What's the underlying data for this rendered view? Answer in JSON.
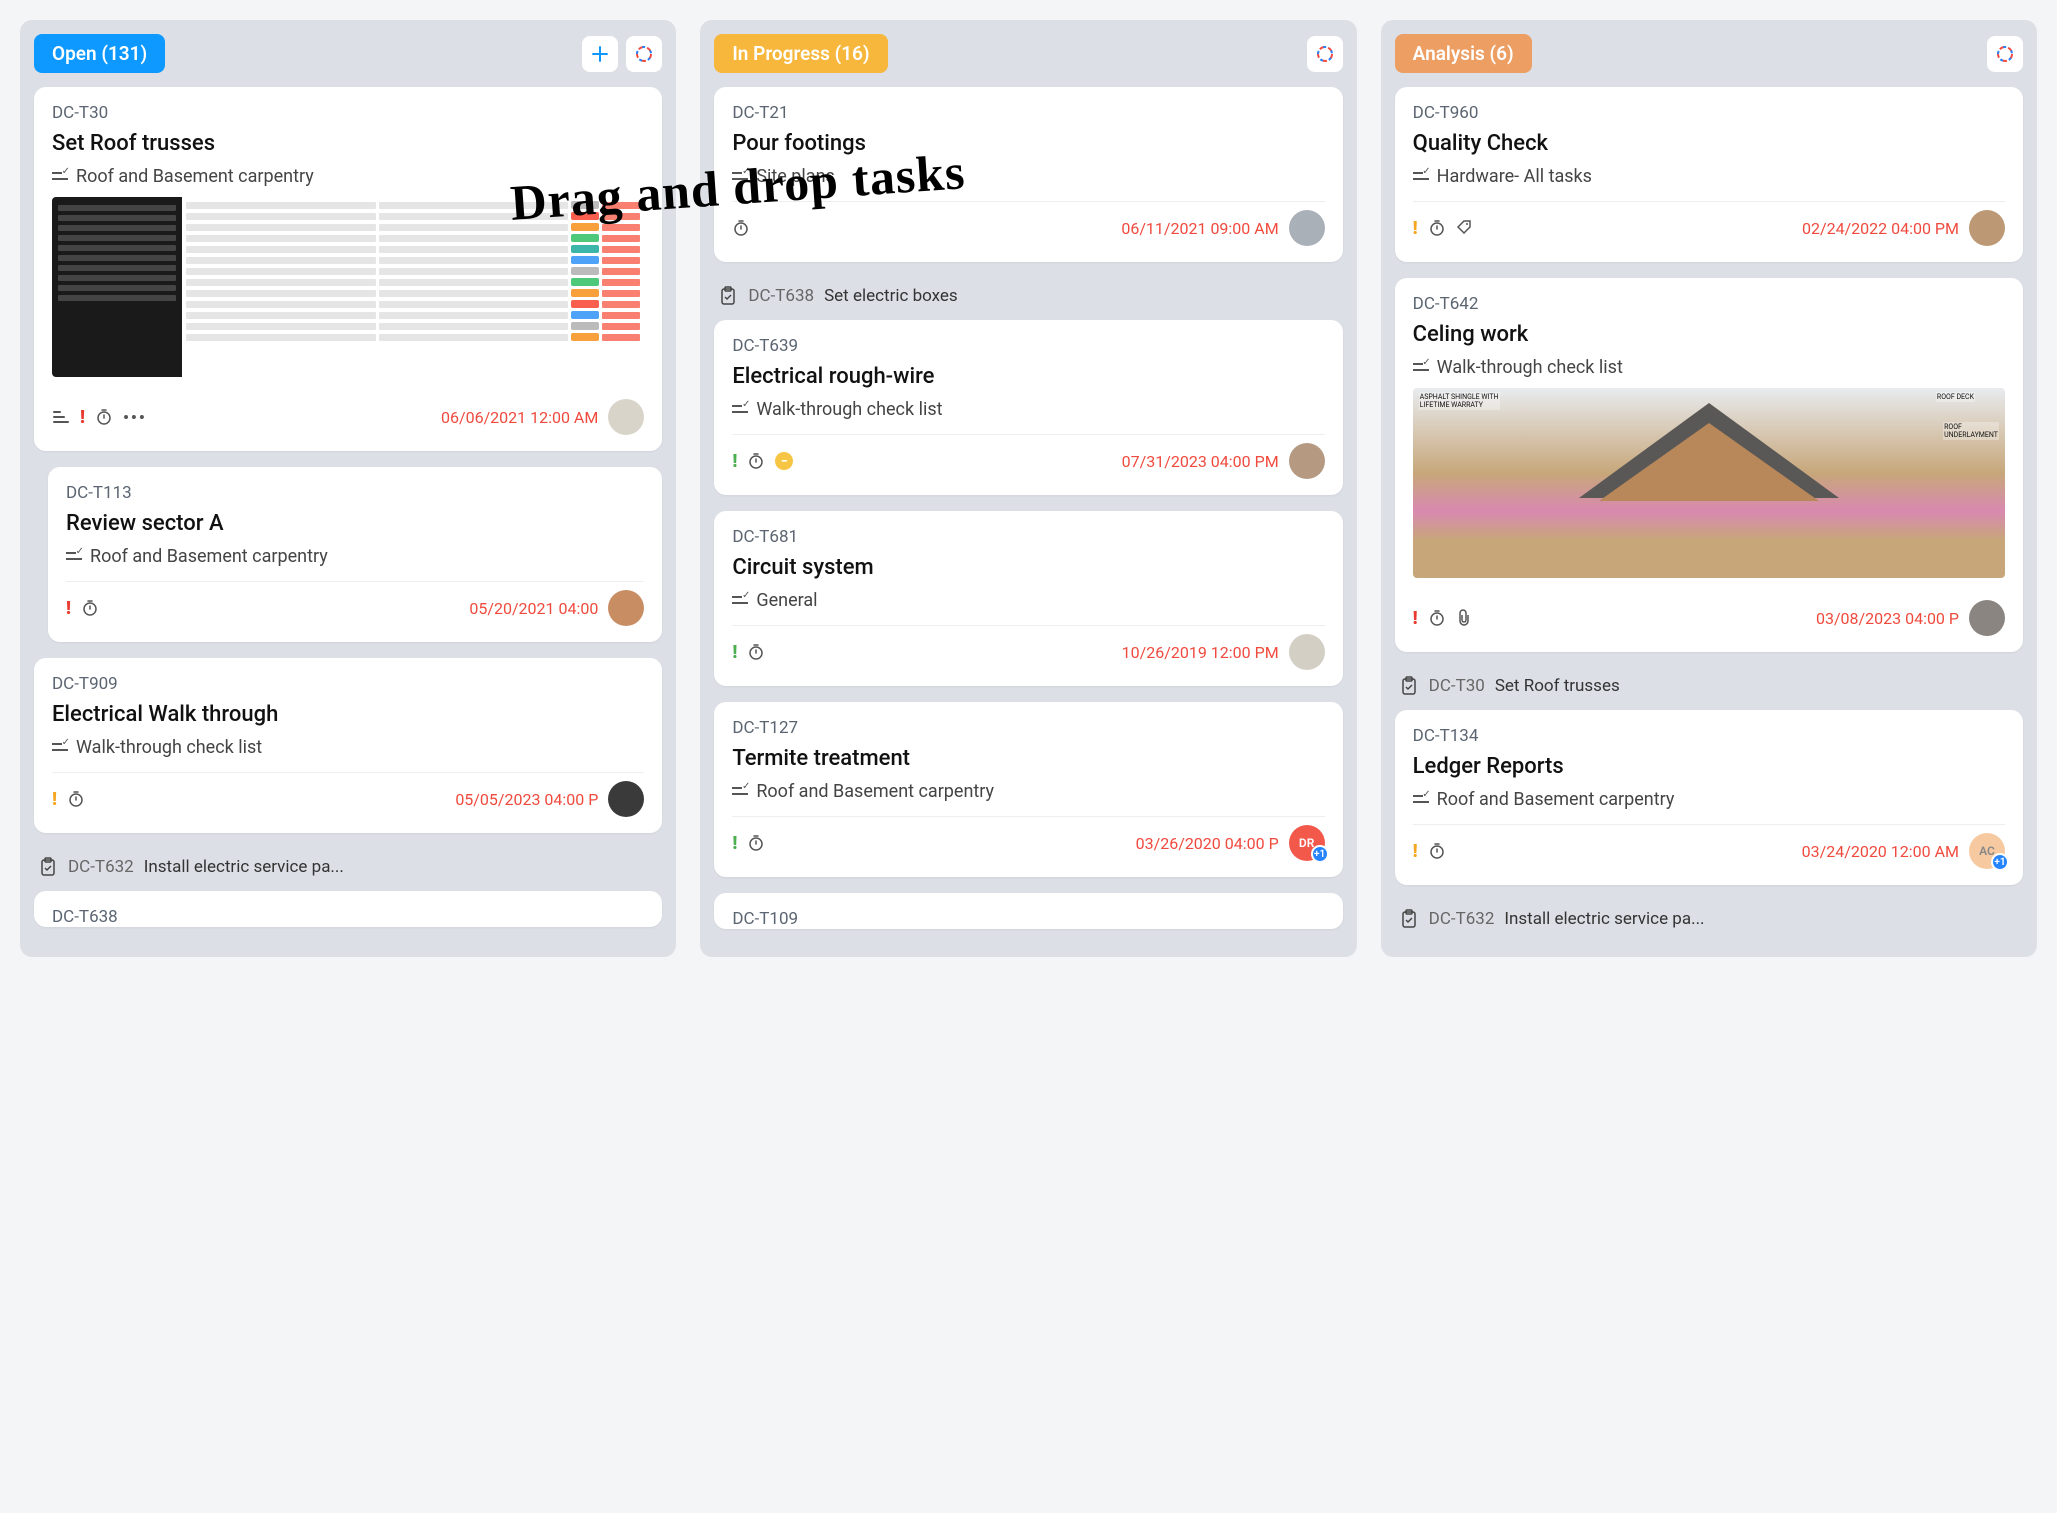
{
  "annotation": "Drag and drop tasks",
  "columns": {
    "open": {
      "label": "Open (131)"
    },
    "inprogress": {
      "label": "In Progress (16)"
    },
    "analysis": {
      "label": "Analysis (6)"
    }
  },
  "cards": {
    "open": [
      {
        "id": "DC-T30",
        "title": "Set Roof trusses",
        "list": "Roof and Basement carpentry",
        "date": "06/06/2021 12:00 AM",
        "priority": "red",
        "thumb": "sheet"
      },
      {
        "id": "DC-T113",
        "title": "Review sector A",
        "list": "Roof and Basement carpentry",
        "date": "05/20/2021 04:00",
        "priority": "red"
      },
      {
        "id": "DC-T909",
        "title": "Electrical Walk through",
        "list": "Walk-through check list",
        "date": "05/05/2023 04:00 P",
        "priority": "orange"
      }
    ],
    "open_linked": {
      "id": "DC-T632",
      "title": "Install electric service pa..."
    },
    "open_partial_id": "DC-T638",
    "inprogress": [
      {
        "id": "DC-T21",
        "title": "Pour footings",
        "list": "Site plans",
        "date": "06/11/2021 09:00 AM",
        "priority": null
      },
      {
        "id": "DC-T639",
        "title": "Electrical rough-wire",
        "list": "Walk-through check list",
        "date": "07/31/2023 04:00 PM",
        "priority": "green",
        "yellow_minus": true
      },
      {
        "id": "DC-T681",
        "title": "Circuit system",
        "list": "General",
        "date": "10/26/2019 12:00 PM",
        "priority": "green"
      },
      {
        "id": "DC-T127",
        "title": "Termite treatment",
        "list": "Roof and Basement carpentry",
        "date": "03/26/2020 04:00 P",
        "priority": "green",
        "avatar_label": "DR",
        "plus_one": true
      }
    ],
    "inprogress_linked": {
      "id": "DC-T638",
      "title": "Set electric boxes"
    },
    "inprogress_partial_id": "DC-T109",
    "analysis": [
      {
        "id": "DC-T960",
        "title": "Quality Check",
        "list": "Hardware- All tasks",
        "date": "02/24/2022 04:00 PM",
        "priority": "orange",
        "show_tag": true
      },
      {
        "id": "DC-T642",
        "title": "Celing work",
        "list": "Walk-through check list",
        "date": "03/08/2023 04:00 P",
        "priority": "red",
        "thumb": "roof",
        "show_clip": true
      },
      {
        "id": "DC-T134",
        "title": "Ledger Reports",
        "list": "Roof and Basement carpentry",
        "date": "03/24/2020 12:00 AM",
        "priority": "orange",
        "avatar_label": "AC",
        "plus_one": true
      }
    ],
    "analysis_linked": {
      "id": "DC-T30",
      "title": "Set Roof trusses"
    },
    "analysis_linked2": {
      "id": "DC-T632",
      "title": "Install electric service pa..."
    }
  }
}
